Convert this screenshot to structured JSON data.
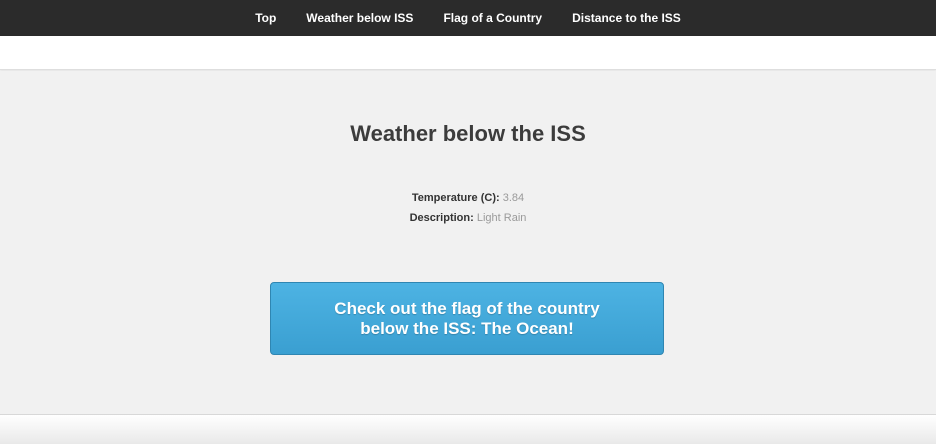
{
  "nav": {
    "items": [
      {
        "label": "Top"
      },
      {
        "label": "Weather below ISS"
      },
      {
        "label": "Flag of a Country"
      },
      {
        "label": "Distance to the ISS"
      }
    ]
  },
  "weather": {
    "title": "Weather below the ISS",
    "temperature_label": "Temperature (C):",
    "temperature_value": "3.84",
    "description_label": "Description:",
    "description_value": "Light Rain"
  },
  "flag_button": {
    "label": "Check out the flag of the country below the ISS: The Ocean!"
  },
  "colors": {
    "nav_bg": "#2b2b2b",
    "button_bg": "#3fa9dd",
    "page_bg": "#f2f2f2"
  }
}
